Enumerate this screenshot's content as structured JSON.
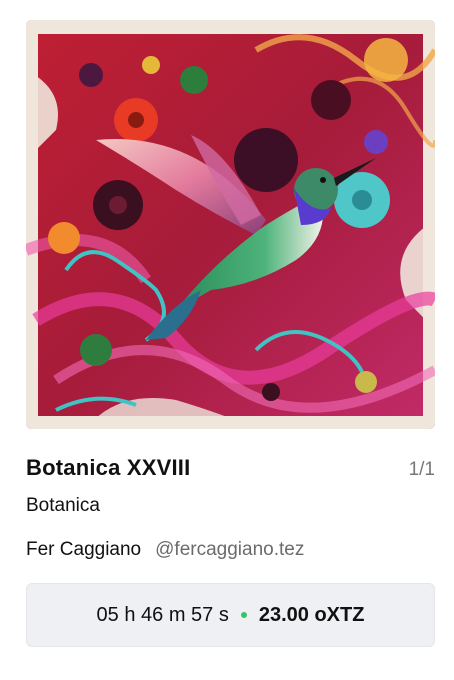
{
  "artwork": {
    "title": "Botanica XXVIII",
    "edition": "1/1",
    "collection": "Botanica",
    "image_icon": "hummingbird-artwork"
  },
  "artist": {
    "name": "Fer Caggiano",
    "handle": "@fercaggiano.tez"
  },
  "auction": {
    "countdown": "05 h 46 m 57 s",
    "price": "23.00 oXTZ",
    "status_color": "#36c46a"
  }
}
